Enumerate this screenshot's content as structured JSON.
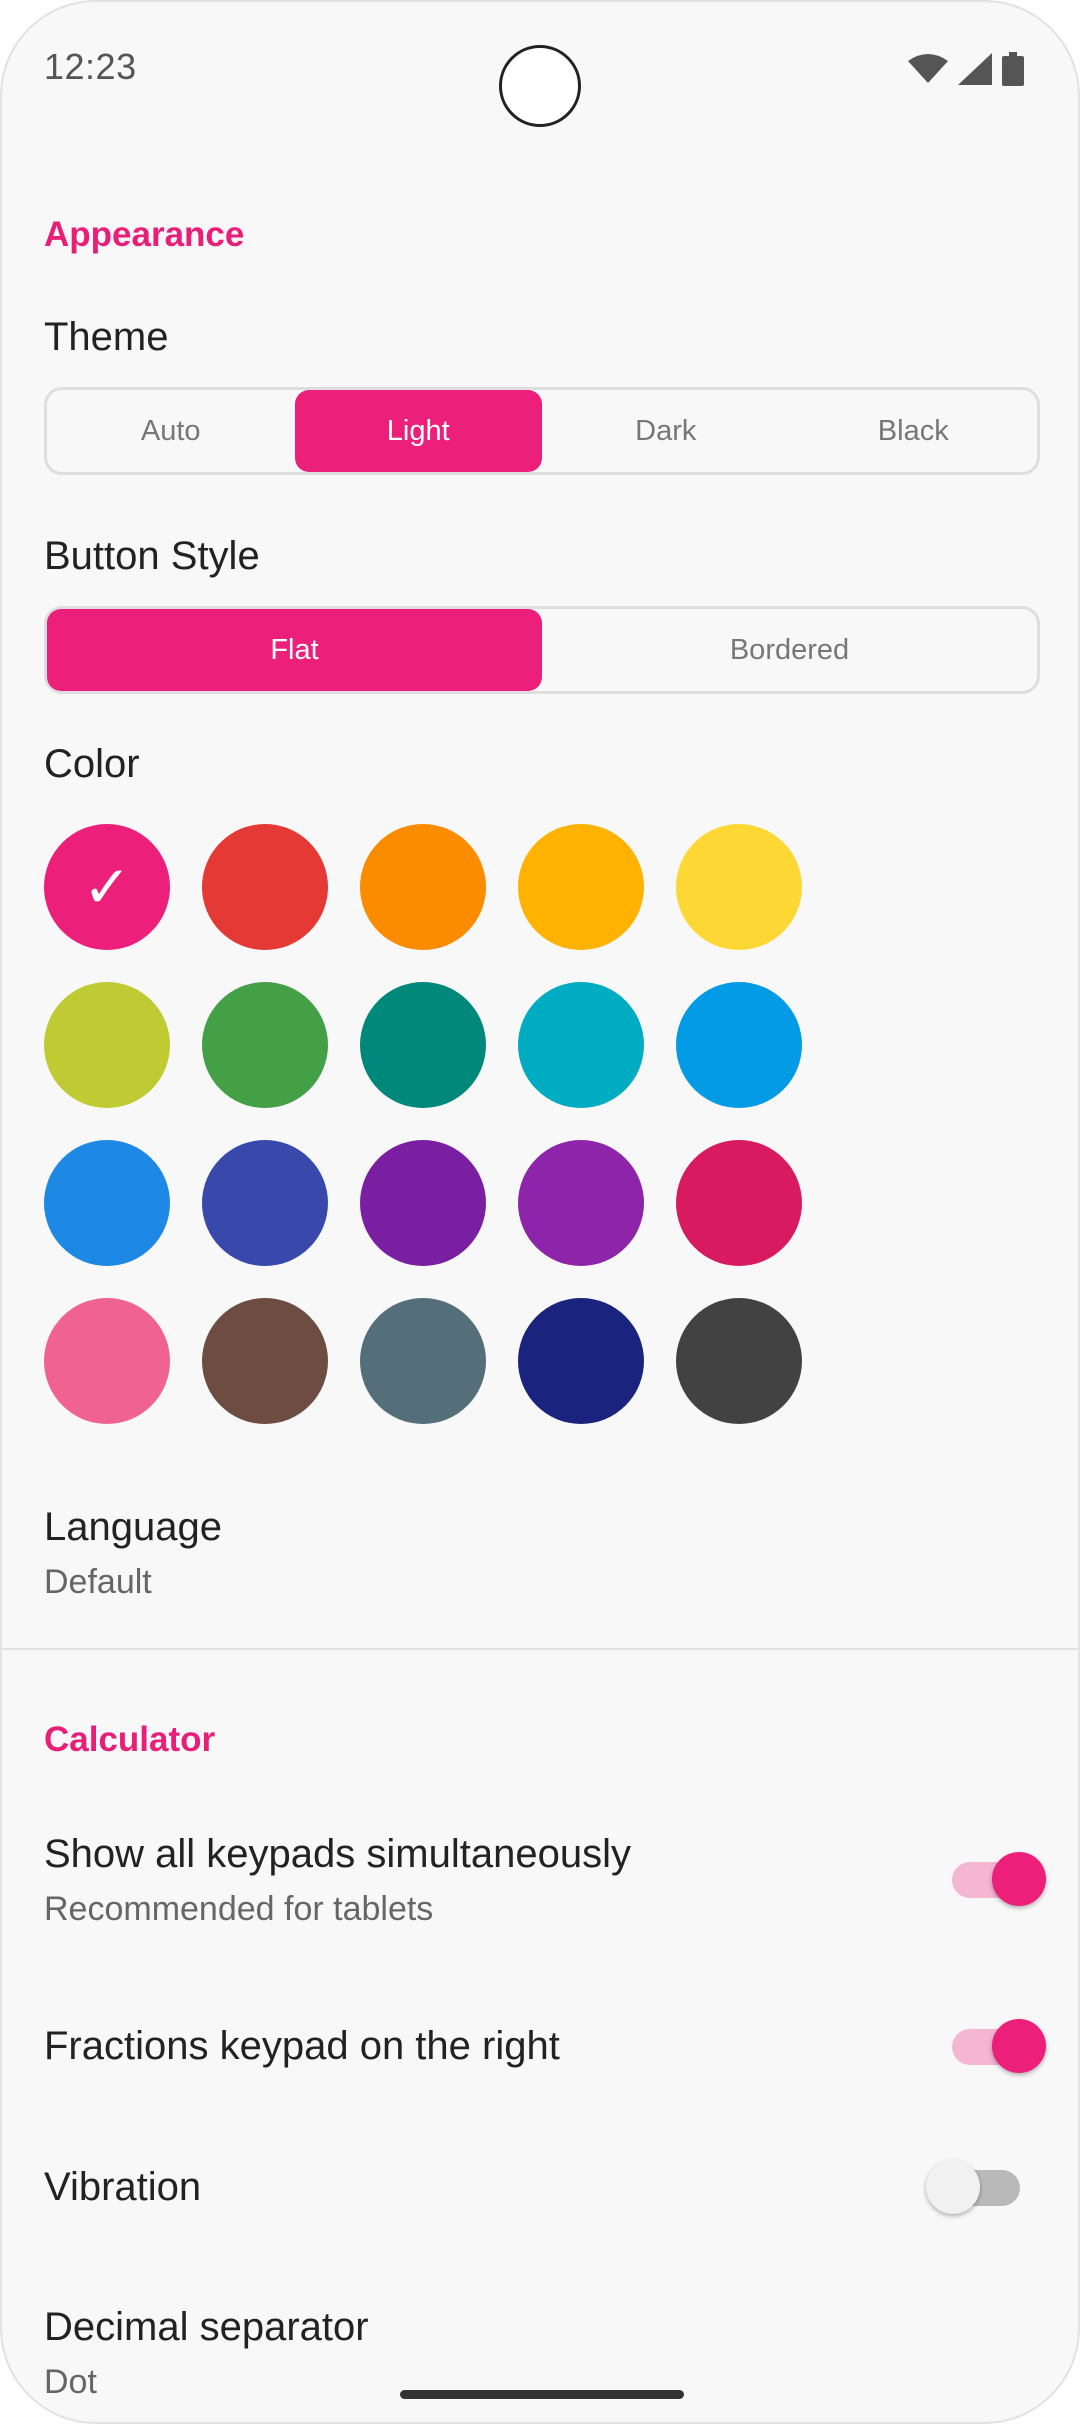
{
  "status": {
    "time": "12:23"
  },
  "appearance": {
    "title": "Appearance",
    "theme": {
      "label": "Theme",
      "options": [
        "Auto",
        "Light",
        "Dark",
        "Black"
      ],
      "selected": "Light"
    },
    "button_style": {
      "label": "Button Style",
      "options": [
        "Flat",
        "Bordered"
      ],
      "selected": "Flat"
    },
    "color": {
      "label": "Color",
      "selected_index": 0,
      "swatches": [
        "#ec1f7a",
        "#e53935",
        "#fb8c00",
        "#ffb300",
        "#fdd835",
        "#c0ca33",
        "#43a047",
        "#00897b",
        "#00acc1",
        "#039be5",
        "#1e88e5",
        "#3949ab",
        "#7b1fa2",
        "#8e24aa",
        "#d81b60",
        "#f06292",
        "#6d4c41",
        "#546e7a",
        "#1a237e",
        "#424242"
      ]
    },
    "language": {
      "label": "Language",
      "value": "Default"
    }
  },
  "calculator": {
    "title": "Calculator",
    "show_all_keypads": {
      "label": "Show all keypads simultaneously",
      "sublabel": "Recommended for tablets",
      "on": true
    },
    "fractions_right": {
      "label": "Fractions keypad on the right",
      "on": true
    },
    "vibration": {
      "label": "Vibration",
      "on": false
    },
    "decimal_separator": {
      "label": "Decimal separator",
      "value": "Dot"
    }
  },
  "colors": {
    "accent": "#ec1f7a"
  }
}
